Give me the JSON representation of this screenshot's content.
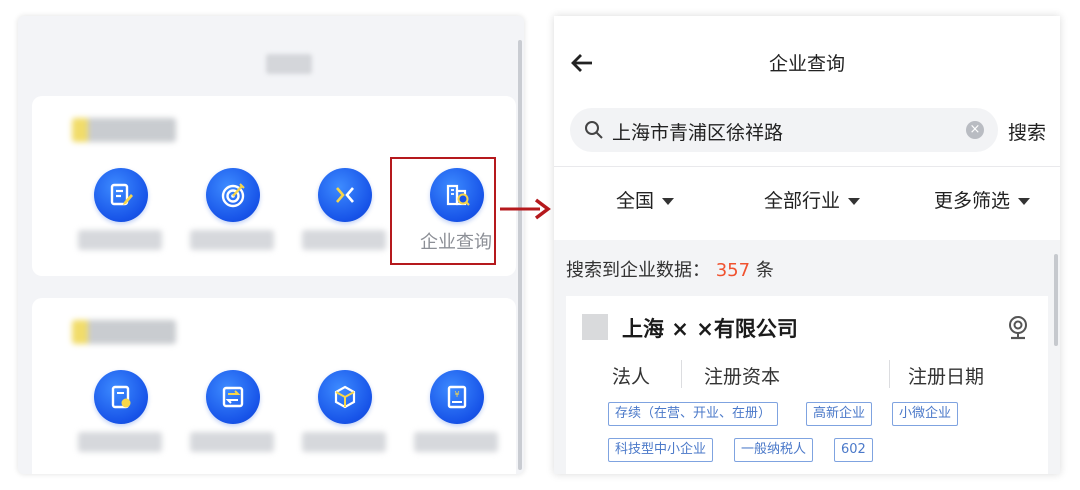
{
  "left_panel": {
    "feature_label": "企业查询"
  },
  "right_panel": {
    "header": {
      "title": "企业查询"
    },
    "search": {
      "value": "上海市青浦区徐祥路",
      "button_label": "搜索"
    },
    "filters": [
      {
        "label": "全国"
      },
      {
        "label": "全部行业"
      },
      {
        "label": "更多筛选"
      }
    ],
    "results": {
      "prefix": "搜索到企业数据：",
      "count": "357",
      "suffix": "条"
    },
    "company": {
      "name": "上海 × ×有限公司",
      "fields": [
        "法人",
        "注册资本",
        "注册日期"
      ],
      "tags": [
        "存续（在营、开业、在册）",
        "高新企业",
        "小微企业",
        "科技型中小企业",
        "一般纳税人",
        "602"
      ]
    }
  },
  "colors": {
    "icon_blue": "#1753e8",
    "highlight_red": "#b5191d",
    "count_orange": "#f0522f",
    "tag_blue": "#4b79c9"
  }
}
